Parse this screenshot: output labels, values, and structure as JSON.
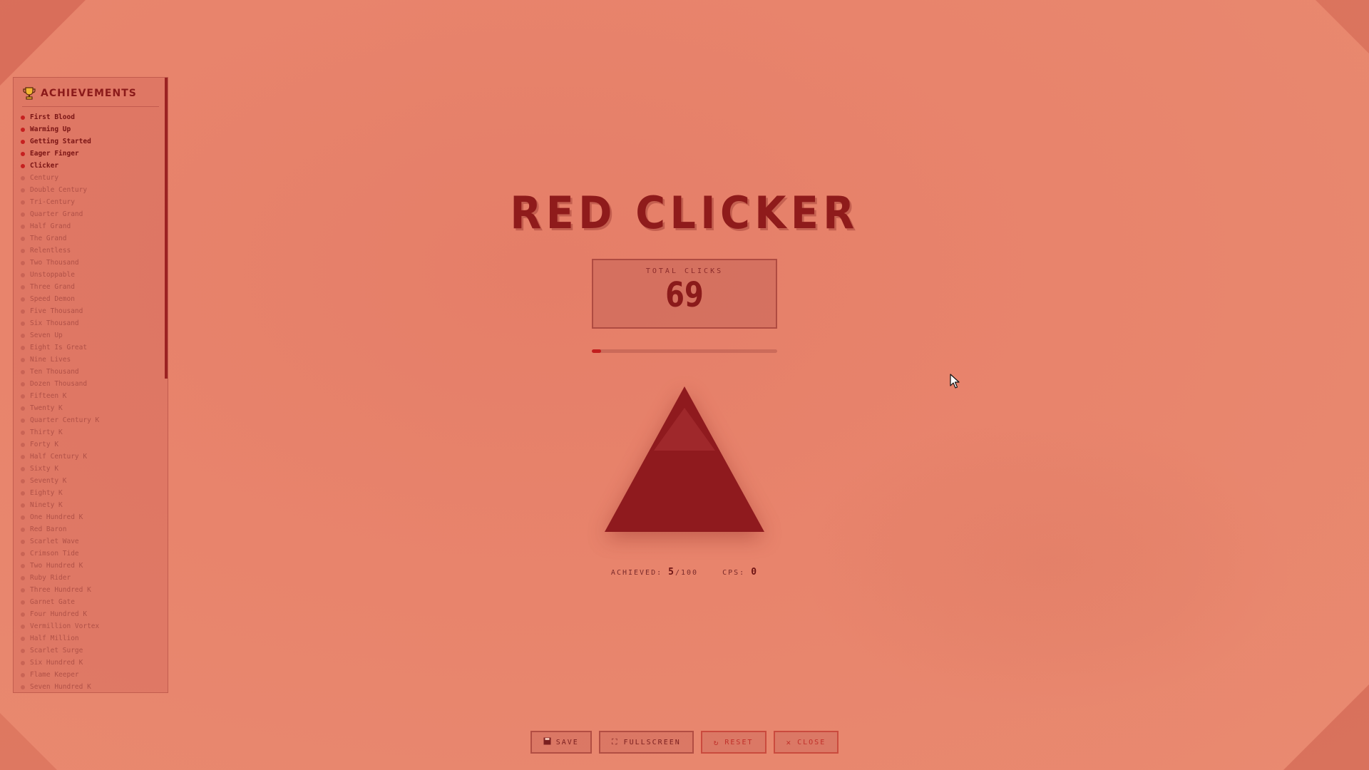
{
  "sidebar": {
    "title": "ACHIEVEMENTS",
    "items": [
      {
        "label": "First Blood",
        "unlocked": true
      },
      {
        "label": "Warming Up",
        "unlocked": true
      },
      {
        "label": "Getting Started",
        "unlocked": true
      },
      {
        "label": "Eager Finger",
        "unlocked": true
      },
      {
        "label": "Clicker",
        "unlocked": true
      },
      {
        "label": "Century",
        "unlocked": false
      },
      {
        "label": "Double Century",
        "unlocked": false
      },
      {
        "label": "Tri-Century",
        "unlocked": false
      },
      {
        "label": "Quarter Grand",
        "unlocked": false
      },
      {
        "label": "Half Grand",
        "unlocked": false
      },
      {
        "label": "The Grand",
        "unlocked": false
      },
      {
        "label": "Relentless",
        "unlocked": false
      },
      {
        "label": "Two Thousand",
        "unlocked": false
      },
      {
        "label": "Unstoppable",
        "unlocked": false
      },
      {
        "label": "Three Grand",
        "unlocked": false
      },
      {
        "label": "Speed Demon",
        "unlocked": false
      },
      {
        "label": "Five Thousand",
        "unlocked": false
      },
      {
        "label": "Six Thousand",
        "unlocked": false
      },
      {
        "label": "Seven Up",
        "unlocked": false
      },
      {
        "label": "Eight Is Great",
        "unlocked": false
      },
      {
        "label": "Nine Lives",
        "unlocked": false
      },
      {
        "label": "Ten Thousand",
        "unlocked": false
      },
      {
        "label": "Dozen Thousand",
        "unlocked": false
      },
      {
        "label": "Fifteen K",
        "unlocked": false
      },
      {
        "label": "Twenty K",
        "unlocked": false
      },
      {
        "label": "Quarter Century K",
        "unlocked": false
      },
      {
        "label": "Thirty K",
        "unlocked": false
      },
      {
        "label": "Forty K",
        "unlocked": false
      },
      {
        "label": "Half Century K",
        "unlocked": false
      },
      {
        "label": "Sixty K",
        "unlocked": false
      },
      {
        "label": "Seventy K",
        "unlocked": false
      },
      {
        "label": "Eighty K",
        "unlocked": false
      },
      {
        "label": "Ninety K",
        "unlocked": false
      },
      {
        "label": "One Hundred K",
        "unlocked": false
      },
      {
        "label": "Red Baron",
        "unlocked": false
      },
      {
        "label": "Scarlet Wave",
        "unlocked": false
      },
      {
        "label": "Crimson Tide",
        "unlocked": false
      },
      {
        "label": "Two Hundred K",
        "unlocked": false
      },
      {
        "label": "Ruby Rider",
        "unlocked": false
      },
      {
        "label": "Three Hundred K",
        "unlocked": false
      },
      {
        "label": "Garnet Gate",
        "unlocked": false
      },
      {
        "label": "Four Hundred K",
        "unlocked": false
      },
      {
        "label": "Vermillion Vortex",
        "unlocked": false
      },
      {
        "label": "Half Million",
        "unlocked": false
      },
      {
        "label": "Scarlet Surge",
        "unlocked": false
      },
      {
        "label": "Six Hundred K",
        "unlocked": false
      },
      {
        "label": "Flame Keeper",
        "unlocked": false
      },
      {
        "label": "Seven Hundred K",
        "unlocked": false
      }
    ]
  },
  "game": {
    "title": "RED CLICKER",
    "counter_label": "TOTAL CLICKS",
    "total_clicks": "69",
    "progress_fraction": 0.05,
    "achieved_label": "ACHIEVED:",
    "achieved_count": "5",
    "achieved_total": "/100",
    "cps_label": "CPS:",
    "cps_value": "0"
  },
  "toolbar": {
    "save_label": "SAVE",
    "fullscreen_label": "FULLSCREEN",
    "reset_label": "RESET",
    "close_label": "CLOSE"
  },
  "colors": {
    "background": "#e8846c",
    "accent": "#8b1a1a",
    "triangle": "#8f1a1e",
    "unlocked_dot": "#c62020"
  }
}
